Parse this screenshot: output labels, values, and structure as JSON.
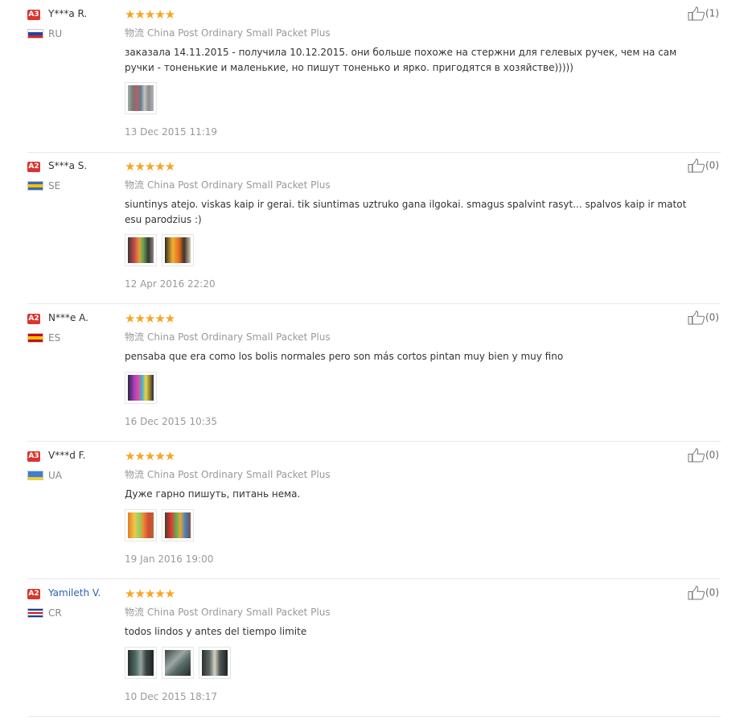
{
  "shipping_cn": "物流",
  "stars": "★★★★★",
  "reviews": [
    {
      "level": "A3",
      "name": "Y***a R.",
      "name_is_link": false,
      "country": "RU",
      "flag": [
        "#ffffff",
        "#2044a8",
        "#d52b1e"
      ],
      "shipping": "China Post Ordinary Small Packet Plus",
      "text": "заказала 14.11.2015 - получила 10.12.2015. они больше похоже на стержни для гелевых ручек, чем на сам ручки - тоненькие и маленькие, но пишут тоненько и ярко. пригодятся в хозяйстве)))))",
      "photos": [
        "linear-gradient(90deg,#a7a9ab 0%,#6d7b6e 20%,#b95c6a 35%,#5f7d8f 50%,#c7c3bc 65%,#8a8d8f 80%,#b0b0b0 100%)"
      ],
      "date": "13 Dec 2015 11:19",
      "helpful": "(1)"
    },
    {
      "level": "A2",
      "name": "S***a S.",
      "name_is_link": false,
      "country": "SE",
      "flag": [
        "#3a6ab0",
        "#f2c200",
        "#3a6ab0"
      ],
      "shipping": "China Post Ordinary Small Packet Plus",
      "text": "siuntinys atejo. viskas kaip ir gerai. tik siuntimas uztruko gana ilgokai. smagus spalvint rasyt... spalvos kaip ir matot esu parodzius :)",
      "photos": [
        "linear-gradient(90deg,#3b3733 0%,#c8494b 25%,#e2a13a 45%,#61a456 60%,#383530 80%,#8c8781 100%)",
        "linear-gradient(90deg,#2f2a25 0%,#f0b131 30%,#e76a1f 55%,#3b342c 75%,#d7c9ab 100%)"
      ],
      "date": "12 Apr 2016 22:20",
      "helpful": "(0)"
    },
    {
      "level": "A2",
      "name": "N***e A.",
      "name_is_link": false,
      "country": "ES",
      "flag": [
        "#c60b1e",
        "#ffc400",
        "#c60b1e"
      ],
      "shipping": "China Post Ordinary Small Packet Plus",
      "text": "pensaba que era como los bolis normales pero son más cortos pintan muy bien y muy fino",
      "photos": [
        "linear-gradient(90deg,#2b2a3a 0%,#a53ec9 25%,#e74b8f 40%,#3ab3d9 55%,#f2d23a 70%,#2b2a3a 100%)"
      ],
      "date": "16 Dec 2015 10:35",
      "helpful": "(0)"
    },
    {
      "level": "A3",
      "name": "V***d F.",
      "name_is_link": false,
      "country": "UA",
      "flag": [
        "#3b7fd4",
        "#3b7fd4",
        "#f5d20b"
      ],
      "shipping": "China Post Ordinary Small Packet Plus",
      "text": "Дуже гарно пишуть, питань нема.",
      "photos": [
        "linear-gradient(90deg,#e07a2a 0%,#f4c542 25%,#8ed16a 45%,#f28b2c 60%,#d24b3a 80%,#b6662c 100%)",
        "linear-gradient(90deg,#4a3a30 0%,#e2392c 25%,#57b45a 45%,#f2a12c 60%,#3d82c8 80%,#8a4b36 100%)"
      ],
      "date": "19 Jan 2016 19:00",
      "helpful": "(0)"
    },
    {
      "level": "A2",
      "name": "Yamileth V.",
      "name_is_link": true,
      "country": "CR",
      "flag": [
        "#1f3f8f",
        "#ffffff",
        "#ce1126",
        "#ffffff",
        "#1f3f8f"
      ],
      "shipping": "China Post Ordinary Small Packet Plus",
      "text": "todos lindos y antes del tiempo limite",
      "photos": [
        "linear-gradient(90deg,#2a2f30 0%,#4d6b64 30%,#97a4a1 50%,#3e4847 70%,#222 100%)",
        "linear-gradient(135deg,#3c4442 0%,#9aa7a4 40%,#5b6d6a 60%,#262b2a 100%)",
        "linear-gradient(90deg,#2b2f2f 0%,#5e6a68 30%,#d6d2c6 50%,#4d5755 70%,#1f2222 100%)"
      ],
      "date": "10 Dec 2015 18:17",
      "helpful": "(0)"
    }
  ]
}
